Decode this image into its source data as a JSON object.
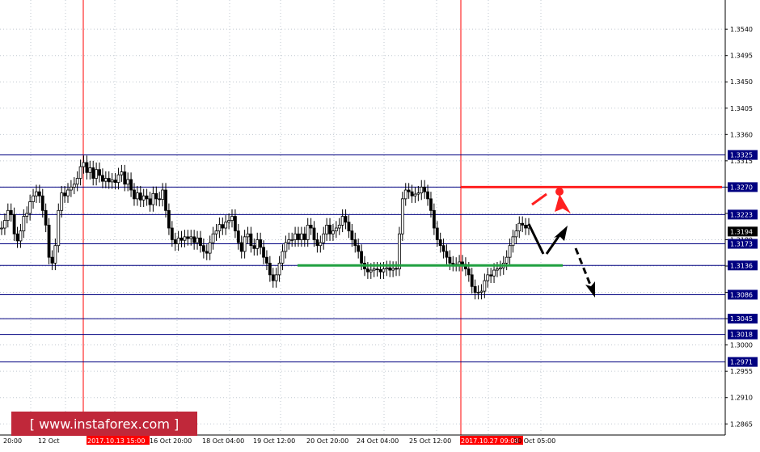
{
  "watermark": "[ www.instaforex.com ]",
  "colors": {
    "candles": "#000000",
    "level_line": "#000080",
    "grid": "#c0c8d0",
    "vline": "#ff0000",
    "resistance": "#ff2020",
    "support": "#20a040",
    "badge_bg": "#000080",
    "date_badge_bg": "#ff0000",
    "watermark_bg": "#c0283a"
  },
  "chart_data": {
    "type": "candlestick",
    "ylim": [
      1.2846,
      1.359
    ],
    "grid": true,
    "y_ticks": [
      1.2865,
      1.291,
      1.2955,
      1.3,
      1.3045,
      1.309,
      1.3135,
      1.318,
      1.3225,
      1.327,
      1.3315,
      1.336,
      1.3405,
      1.345,
      1.3495,
      1.354
    ],
    "x_ticks": [
      "20:00",
      "12 Oct",
      "2017.10.13 15:00",
      "16 Oct 20:00",
      "18 Oct 04:00",
      "19 Oct 12:00",
      "20 Oct 20:00",
      "24 Oct 04:00",
      "25 Oct 12:00",
      "2017.10.27 09:00",
      "30 Oct 05:00"
    ],
    "x_tick_highlight": [
      "2017.10.13 15:00",
      "2017.10.27 09:00"
    ],
    "levels": [
      {
        "value": 1.3325,
        "label": "1.3325"
      },
      {
        "value": 1.327,
        "label": "1.3270"
      },
      {
        "value": 1.3223,
        "label": "1.3223"
      },
      {
        "value": 1.3173,
        "label": "1.3173"
      },
      {
        "value": 1.3136,
        "label": "1.3136"
      },
      {
        "value": 1.3086,
        "label": "1.3086"
      },
      {
        "value": 1.3045,
        "label": "1.3045"
      },
      {
        "value": 1.3018,
        "label": "1.3018"
      },
      {
        "value": 1.2971,
        "label": "1.2971"
      }
    ],
    "current_price": {
      "value": 1.3194,
      "label": "1.3194"
    },
    "vertical_markers": [
      "2017.10.13 15:00",
      "2017.10.27 09:00"
    ],
    "resistance_line": {
      "value": 1.327,
      "from": "2017.10.27 09:00",
      "to": "end"
    },
    "support_line": {
      "value": 1.3136,
      "from": "20 Oct 20:00",
      "to": "30 Oct 05:00"
    },
    "close_series": [
      1.32,
      1.3213,
      1.323,
      1.3223,
      1.319,
      1.3178,
      1.3195,
      1.322,
      1.3225,
      1.3245,
      1.3255,
      1.3262,
      1.3255,
      1.323,
      1.3205,
      1.315,
      1.314,
      1.317,
      1.323,
      1.326,
      1.3255,
      1.3265,
      1.327,
      1.3275,
      1.3285,
      1.3305,
      1.3312,
      1.3295,
      1.3303,
      1.3285,
      1.33,
      1.329,
      1.328,
      1.3285,
      1.3279,
      1.3282,
      1.3278,
      1.3291,
      1.3296,
      1.3275,
      1.3283,
      1.3265,
      1.325,
      1.326,
      1.3248,
      1.3255,
      1.325,
      1.324,
      1.3259,
      1.325,
      1.3249,
      1.3265,
      1.323,
      1.32,
      1.318,
      1.3173,
      1.3183,
      1.3179,
      1.3185,
      1.3182,
      1.3185,
      1.3175,
      1.3183,
      1.317,
      1.316,
      1.3157,
      1.3175,
      1.319,
      1.3195,
      1.3206,
      1.32,
      1.321,
      1.3213,
      1.322,
      1.3195,
      1.3175,
      1.316,
      1.3185,
      1.319,
      1.317,
      1.3165,
      1.318,
      1.3167,
      1.315,
      1.314,
      1.312,
      1.311,
      1.312,
      1.314,
      1.316,
      1.3175,
      1.318,
      1.318,
      1.319,
      1.318,
      1.319,
      1.318,
      1.3205,
      1.32,
      1.318,
      1.317,
      1.3175,
      1.319,
      1.3205,
      1.319,
      1.3195,
      1.32,
      1.3205,
      1.322,
      1.321,
      1.3195,
      1.318,
      1.317,
      1.316,
      1.314,
      1.313,
      1.3125,
      1.3128,
      1.313,
      1.3129,
      1.3125,
      1.313,
      1.3132,
      1.3128,
      1.3131,
      1.313,
      1.319,
      1.325,
      1.3265,
      1.3262,
      1.3255,
      1.3258,
      1.326,
      1.327,
      1.3262,
      1.325,
      1.323,
      1.32,
      1.318,
      1.317,
      1.316,
      1.315,
      1.314,
      1.3138,
      1.3138,
      1.3142,
      1.3138,
      1.313,
      1.312,
      1.31,
      1.309,
      1.309,
      1.3092,
      1.311,
      1.312,
      1.3118,
      1.3128,
      1.313,
      1.3132,
      1.314,
      1.315,
      1.317,
      1.3185,
      1.3195,
      1.3208,
      1.3205,
      1.32,
      1.3205
    ]
  }
}
